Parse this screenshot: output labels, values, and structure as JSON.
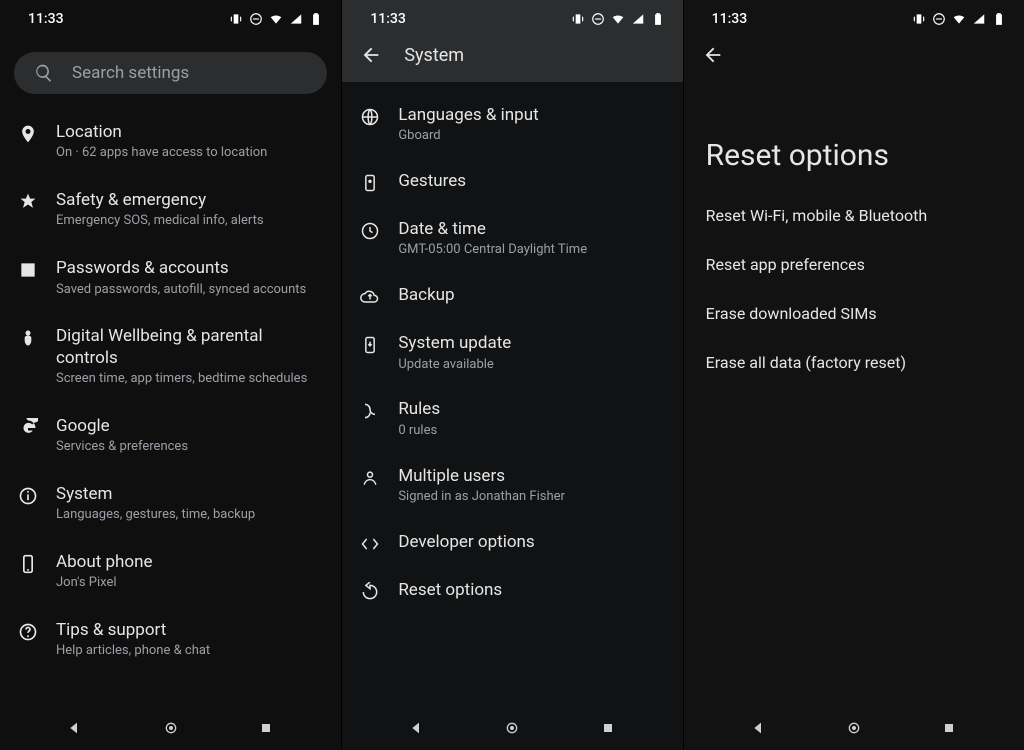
{
  "status": {
    "time": "11:33"
  },
  "panel1": {
    "search_placeholder": "Search settings",
    "items": [
      {
        "title": "Location",
        "sub": "On · 62 apps have access to location"
      },
      {
        "title": "Safety & emergency",
        "sub": "Emergency SOS, medical info, alerts"
      },
      {
        "title": "Passwords & accounts",
        "sub": "Saved passwords, autofill, synced accounts"
      },
      {
        "title": "Digital Wellbeing & parental controls",
        "sub": "Screen time, app timers, bedtime schedules"
      },
      {
        "title": "Google",
        "sub": "Services & preferences"
      },
      {
        "title": "System",
        "sub": "Languages, gestures, time, backup"
      },
      {
        "title": "About phone",
        "sub": "Jon's Pixel"
      },
      {
        "title": "Tips & support",
        "sub": "Help articles, phone & chat"
      }
    ]
  },
  "panel2": {
    "title": "System",
    "items": [
      {
        "title": "Languages & input",
        "sub": "Gboard"
      },
      {
        "title": "Gestures",
        "sub": ""
      },
      {
        "title": "Date & time",
        "sub": "GMT-05:00 Central Daylight Time"
      },
      {
        "title": "Backup",
        "sub": ""
      },
      {
        "title": "System update",
        "sub": "Update available"
      },
      {
        "title": "Rules",
        "sub": "0 rules"
      },
      {
        "title": "Multiple users",
        "sub": "Signed in as Jonathan Fisher"
      },
      {
        "title": "Developer options",
        "sub": ""
      },
      {
        "title": "Reset options",
        "sub": ""
      }
    ]
  },
  "panel3": {
    "title": "Reset options",
    "items": [
      "Reset Wi-Fi, mobile & Bluetooth",
      "Reset app preferences",
      "Erase downloaded SIMs",
      "Erase all data (factory reset)"
    ]
  }
}
